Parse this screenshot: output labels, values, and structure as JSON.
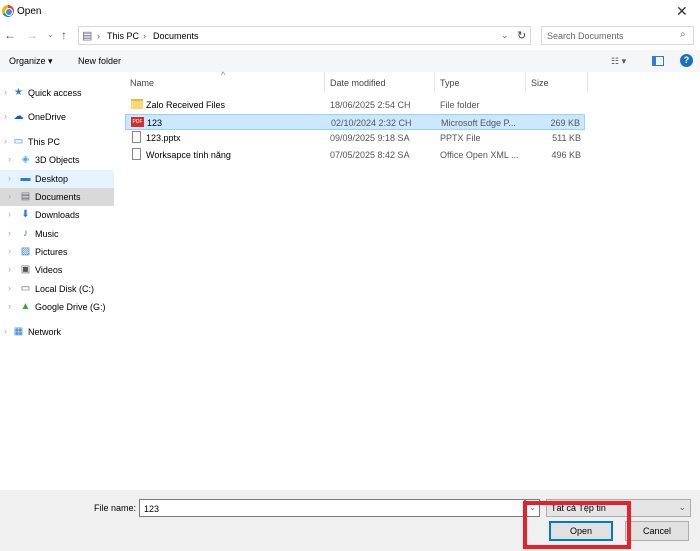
{
  "window": {
    "title": "Open",
    "close": "✕"
  },
  "address": {
    "path": [
      "This PC",
      "Documents"
    ],
    "search_placeholder": "Search Documents"
  },
  "toolbar": {
    "organize": "Organize ▾",
    "new_folder": "New folder",
    "view": "☷ ▾",
    "help": "?"
  },
  "sidebar": {
    "items": [
      {
        "label": "Quick access",
        "icon": "★",
        "color": "#2a7fd4"
      },
      {
        "label": "OneDrive",
        "icon": "☁",
        "color": "#0a64c8"
      },
      {
        "label": "This PC",
        "icon": "▭",
        "color": "#2a7fd4"
      },
      {
        "label": "3D Objects",
        "icon": "◈",
        "color": "#4aa6e0"
      },
      {
        "label": "Desktop",
        "icon": "▬",
        "color": "#2a7fd4"
      },
      {
        "label": "Documents",
        "icon": "▤",
        "color": "#667"
      },
      {
        "label": "Downloads",
        "icon": "⬇",
        "color": "#2a7fd4"
      },
      {
        "label": "Music",
        "icon": "♪",
        "color": "#2a7fd4"
      },
      {
        "label": "Pictures",
        "icon": "▨",
        "color": "#2a7fd4"
      },
      {
        "label": "Videos",
        "icon": "▣",
        "color": "#555"
      },
      {
        "label": "Local Disk (C:)",
        "icon": "▭",
        "color": "#666"
      },
      {
        "label": "Google Drive (G:)",
        "icon": "▲",
        "color": "#34a853"
      },
      {
        "label": "Network",
        "icon": "▦",
        "color": "#2a7fd4"
      }
    ]
  },
  "columns": {
    "name": "Name",
    "date": "Date modified",
    "type": "Type",
    "size": "Size"
  },
  "files": [
    {
      "name": "Zalo Received Files",
      "date": "18/06/2025 2:54 CH",
      "type": "File folder",
      "size": "",
      "icon": "folder"
    },
    {
      "name": "123",
      "date": "02/10/2024 2:32 CH",
      "type": "Microsoft Edge P...",
      "size": "269 KB",
      "icon": "pdf"
    },
    {
      "name": "123.pptx",
      "date": "09/09/2025 9:18 SA",
      "type": "PPTX File",
      "size": "511 KB",
      "icon": "file"
    },
    {
      "name": "Worksapce tính năng",
      "date": "07/05/2025 8:42 SA",
      "type": "Office Open XML ...",
      "size": "496 KB",
      "icon": "doc"
    }
  ],
  "bottom": {
    "file_name_label": "File name:",
    "file_name_value": "123",
    "file_type": "Tất cả Tệp tin",
    "open": "Open",
    "cancel": "Cancel"
  },
  "colors": {
    "selection": "#cce8ff",
    "highlight_box": "#e8202a"
  }
}
